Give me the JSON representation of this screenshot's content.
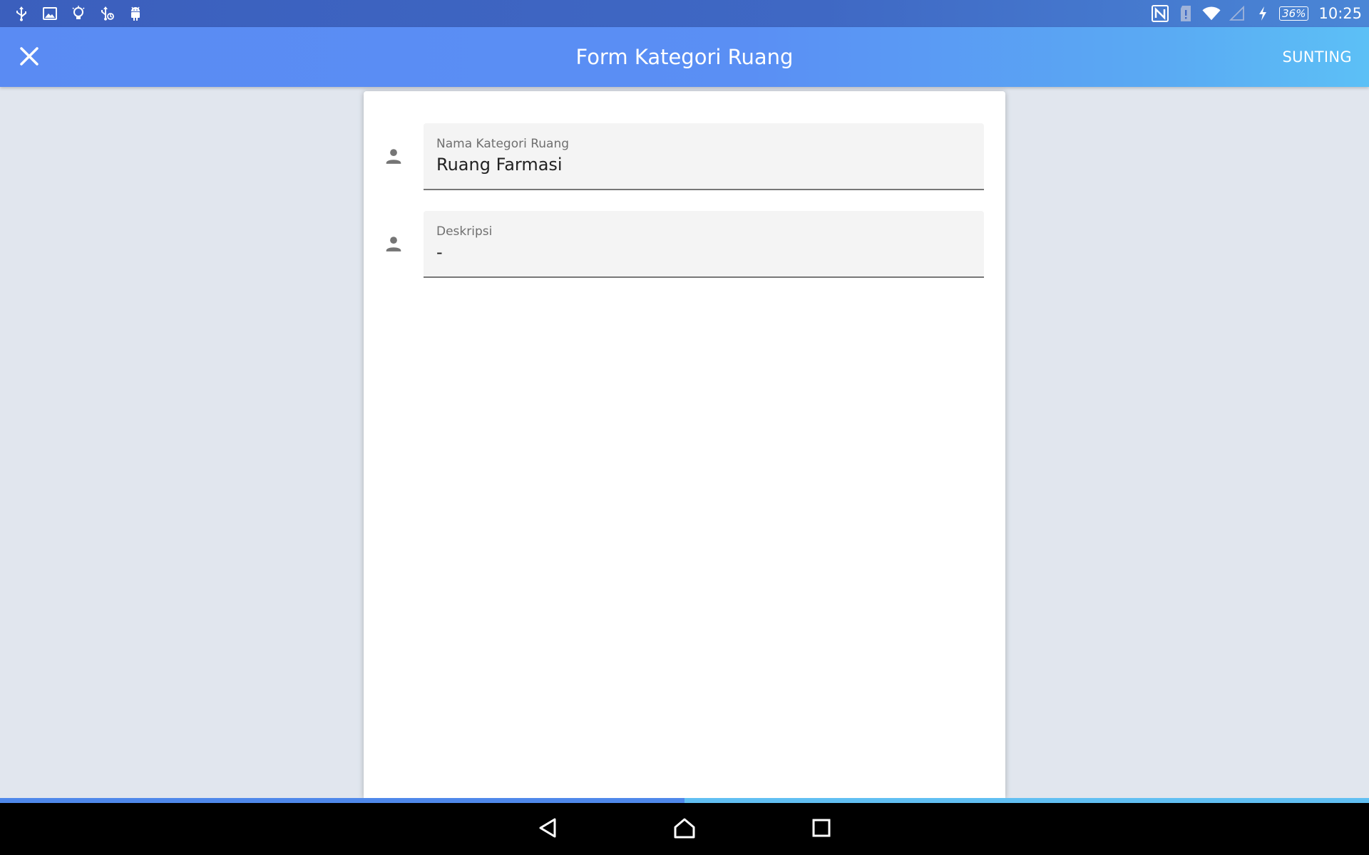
{
  "status_bar": {
    "left_icons": [
      "usb-icon",
      "image-icon",
      "lightbulb-icon",
      "usb-debug-icon",
      "android-icon"
    ],
    "right_icons": [
      "nfc-icon",
      "sim-alert-icon",
      "wifi-icon",
      "cell-signal-icon",
      "charging-icon"
    ],
    "battery": "36%",
    "time": "10:25"
  },
  "app_bar": {
    "title": "Form Kategori Ruang",
    "close_icon": "close-icon",
    "action_label": "SUNTING"
  },
  "form": {
    "fields": [
      {
        "icon": "person-icon",
        "label": "Nama Kategori Ruang",
        "value": "Ruang Farmasi"
      },
      {
        "icon": "person-icon",
        "label": "Deskripsi",
        "value": "-"
      }
    ]
  },
  "progress": {
    "fraction": 0.5
  },
  "nav_bar": {
    "buttons": [
      "back-icon",
      "home-icon",
      "recent-apps-icon"
    ]
  },
  "colors": {
    "app_bar": "#5a8ff4",
    "status_bar": "#3f68c4",
    "background": "#e1e6ee",
    "field_background": "#f4f4f4",
    "progress_fill": "#4f88ea",
    "progress_track": "#61bff2"
  }
}
